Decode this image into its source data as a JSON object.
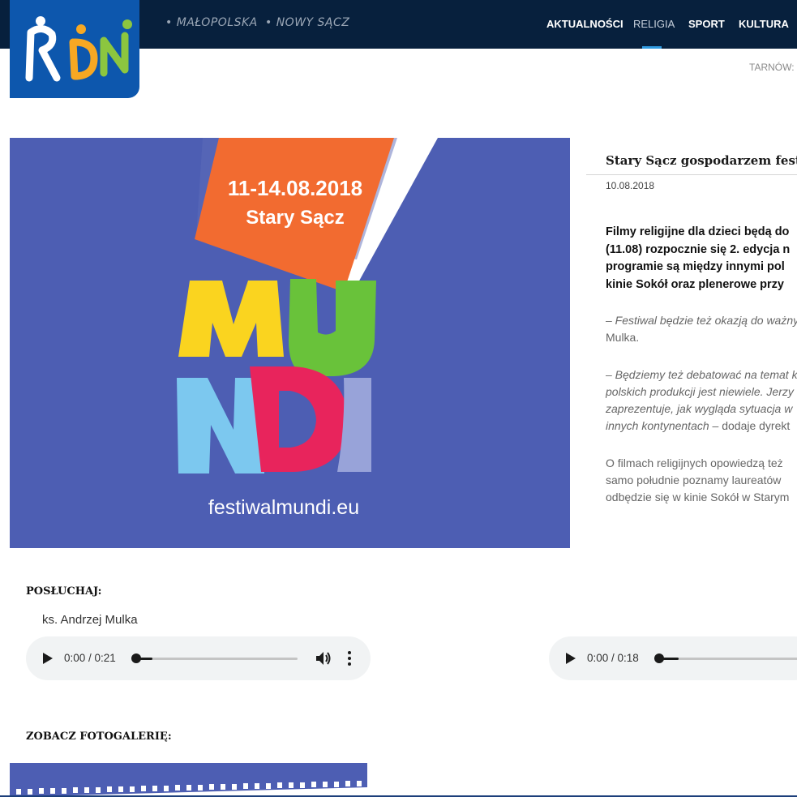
{
  "brand": {
    "logo_text": "RDN",
    "logo_colors": [
      "#ffffff",
      "#f7a823",
      "#8cc63f"
    ]
  },
  "header": {
    "regions": [
      "• MAŁOPOLSKA",
      "• NOWY SĄCZ"
    ],
    "nav": [
      {
        "label": "AKTUALNOŚCI",
        "active": false
      },
      {
        "label": "RELIGIA",
        "active": true
      },
      {
        "label": "SPORT",
        "active": false
      },
      {
        "label": "KULTURA",
        "active": false
      }
    ],
    "city_label": "TARNÓW:"
  },
  "hero": {
    "date_range": "11-14.08.2018",
    "place": "Stary Sącz",
    "logo_letters": [
      "M",
      "U",
      "N",
      "D",
      "I"
    ],
    "url": "festiwalmundi.eu",
    "colors": {
      "background": "#4d5eb3",
      "card": "#f26b30",
      "m": "#fad41f",
      "u": "#69c23a",
      "n": "#7cc8ef",
      "d": "#e8245c",
      "i": "#98a3d9"
    }
  },
  "article": {
    "title": "Stary Sącz gospodarzem festi",
    "date": "10.08.2018",
    "lead_lines": [
      "Filmy religijne dla dzieci będą do",
      "(11.08) rozpocznie się 2. edycja n",
      "programie są między innymi pol",
      "kinie Sokół oraz plenerowe przy"
    ],
    "p1_lines": [
      "– Festiwal będzie też okazją do ważny",
      "Mulka."
    ],
    "p2_lines": [
      "– Będziemy też debatować na temat k",
      "polskich produkcji jest niewiele. Jerzy B",
      "zaprezentuje, jak wygląda sytuacja w",
      "innych kontynentach"
    ],
    "p2_tail": " – dodaje dyrekt",
    "p3_lines": [
      "O filmach religijnych opowiedzą też",
      "samo południe poznamy laureatów",
      "odbędzie się w kinie Sokół w Starym"
    ]
  },
  "listen": {
    "heading": "POSŁUCHAJ:",
    "speaker": "ks. Andrzej Mulka",
    "players": [
      {
        "time": "0:00 / 0:21",
        "progress": 0.0
      },
      {
        "time": "0:00 / 0:18",
        "progress": 0.0
      }
    ]
  },
  "gallery": {
    "heading": "ZOBACZ FOTOGALERIĘ:"
  }
}
